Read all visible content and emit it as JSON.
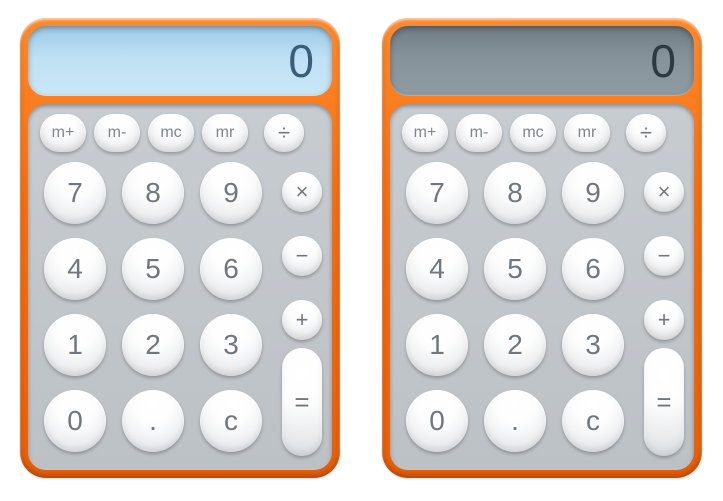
{
  "calculators": [
    {
      "display": "0",
      "theme": "blue"
    },
    {
      "display": "0",
      "theme": "grey"
    }
  ],
  "memory": {
    "mplus": "m+",
    "mminus": "m-",
    "mc": "mc",
    "mr": "mr"
  },
  "ops": {
    "divide": "÷",
    "multiply": "×",
    "minus": "−",
    "plus": "+",
    "equals": "="
  },
  "digits": {
    "d7": "7",
    "d8": "8",
    "d9": "9",
    "d4": "4",
    "d5": "5",
    "d6": "6",
    "d1": "1",
    "d2": "2",
    "d3": "3",
    "d0": "0",
    "dot": ".",
    "clear": "c"
  }
}
